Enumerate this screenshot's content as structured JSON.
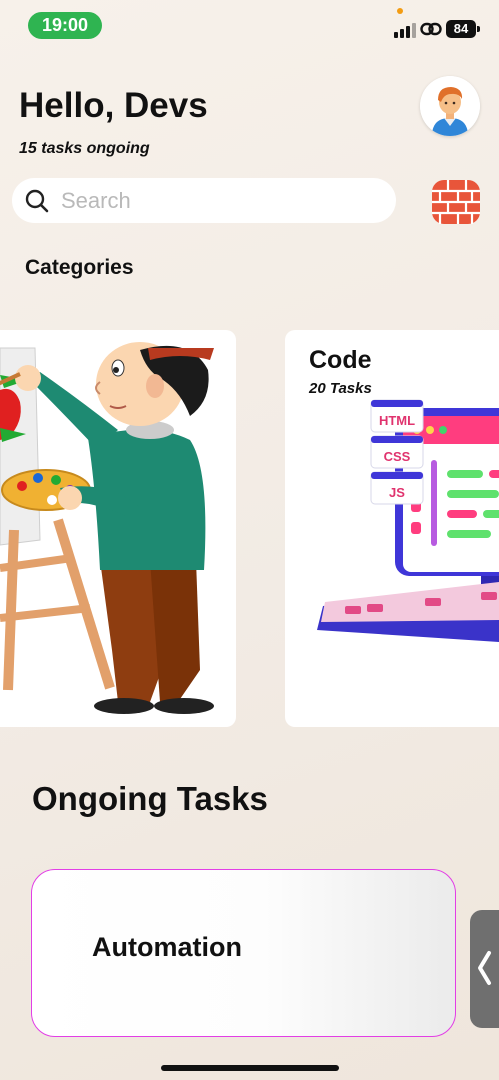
{
  "status_bar": {
    "time": "19:00",
    "battery": "84",
    "time_pill_color": "#2fb451",
    "icons": [
      "cellular-signal-icon",
      "personal-hotspot-link-icon",
      "battery-icon"
    ]
  },
  "header": {
    "greeting": "Hello, Devs",
    "subtitle": "15 tasks ongoing",
    "avatar_icon": "user-avatar-icon"
  },
  "search": {
    "placeholder": "Search",
    "value": "",
    "filter_icon": "brick-pattern-filter-icon",
    "filter_color": "#e8553a"
  },
  "categories": {
    "title": "Categories",
    "cards": [
      {
        "title": "",
        "count": "",
        "illustration": "painter-at-easel"
      },
      {
        "title": "Code",
        "count": "20 Tasks",
        "illustration": "monitor-keyboard-code",
        "tags": [
          "HTML",
          "CSS",
          "JS"
        ]
      }
    ]
  },
  "ongoing": {
    "title": "Ongoing Tasks",
    "tasks": [
      {
        "title": "Automation",
        "border_color": "#e23ee6"
      }
    ]
  },
  "side_handle": {
    "icon": "chevron-left-icon"
  }
}
